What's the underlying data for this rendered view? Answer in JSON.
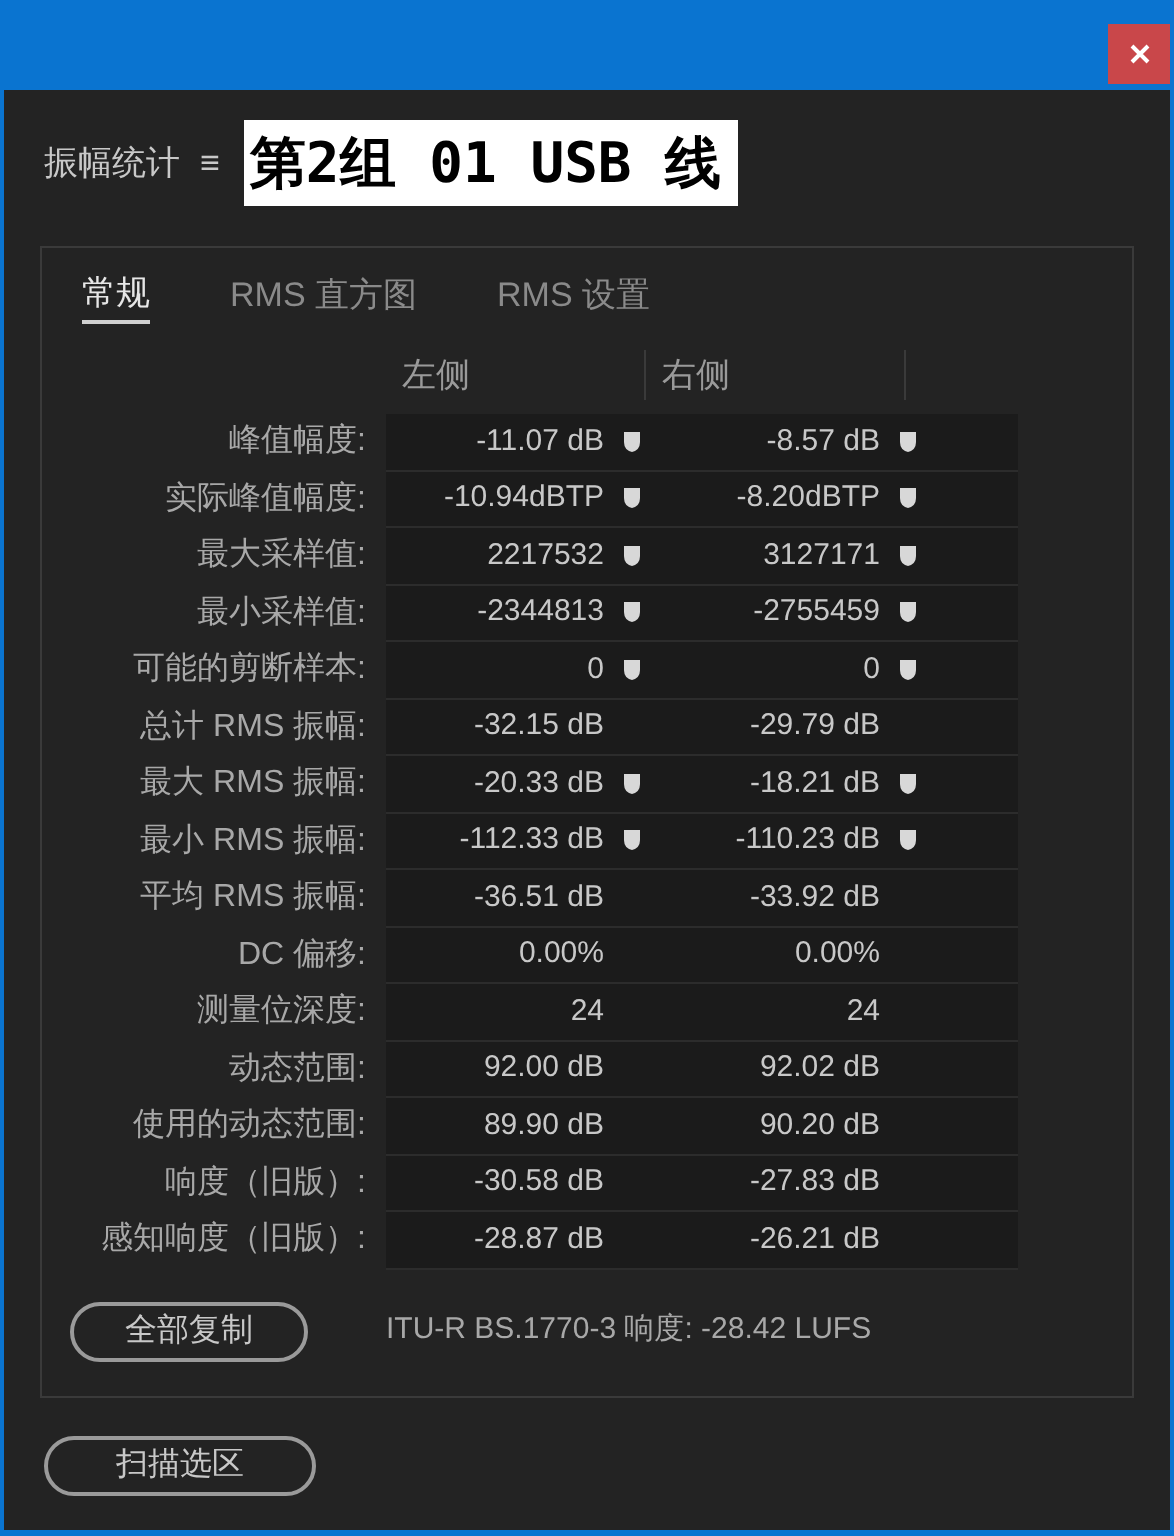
{
  "header": {
    "title": "振幅统计",
    "menu": "≡",
    "file_name": "第2组 01 USB 线"
  },
  "tabs": [
    {
      "label": "常规",
      "selected": true
    },
    {
      "label": "RMS 直方图",
      "selected": false
    },
    {
      "label": "RMS 设置",
      "selected": false
    }
  ],
  "table": {
    "columns": [
      "左侧",
      "右侧"
    ],
    "rows": [
      {
        "label": "峰值幅度:",
        "left": {
          "value": "-11.07 dB",
          "marker": true
        },
        "right": {
          "value": "-8.57 dB",
          "marker": true
        }
      },
      {
        "label": "实际峰值幅度:",
        "left": {
          "value": "-10.94dBTP",
          "marker": true
        },
        "right": {
          "value": "-8.20dBTP",
          "marker": true
        }
      },
      {
        "label": "最大采样值:",
        "left": {
          "value": "2217532",
          "marker": true
        },
        "right": {
          "value": "3127171",
          "marker": true
        }
      },
      {
        "label": "最小采样值:",
        "left": {
          "value": "-2344813",
          "marker": true
        },
        "right": {
          "value": "-2755459",
          "marker": true
        }
      },
      {
        "label": "可能的剪断样本:",
        "left": {
          "value": "0",
          "marker": true
        },
        "right": {
          "value": "0",
          "marker": true
        }
      },
      {
        "label": "总计 RMS 振幅:",
        "left": {
          "value": "-32.15 dB",
          "marker": false
        },
        "right": {
          "value": "-29.79 dB",
          "marker": false
        }
      },
      {
        "label": "最大 RMS 振幅:",
        "left": {
          "value": "-20.33 dB",
          "marker": true
        },
        "right": {
          "value": "-18.21 dB",
          "marker": true
        }
      },
      {
        "label": "最小 RMS 振幅:",
        "left": {
          "value": "-112.33 dB",
          "marker": true
        },
        "right": {
          "value": "-110.23 dB",
          "marker": true
        }
      },
      {
        "label": "平均 RMS 振幅:",
        "left": {
          "value": "-36.51 dB",
          "marker": false
        },
        "right": {
          "value": "-33.92 dB",
          "marker": false
        }
      },
      {
        "label": "DC 偏移:",
        "left": {
          "value": "0.00%",
          "marker": false
        },
        "right": {
          "value": "0.00%",
          "marker": false
        }
      },
      {
        "label": "测量位深度:",
        "left": {
          "value": "24",
          "marker": false
        },
        "right": {
          "value": "24",
          "marker": false
        }
      },
      {
        "label": "动态范围:",
        "left": {
          "value": "92.00 dB",
          "marker": false
        },
        "right": {
          "value": "92.02 dB",
          "marker": false
        }
      },
      {
        "label": "使用的动态范围:",
        "left": {
          "value": "89.90 dB",
          "marker": false
        },
        "right": {
          "value": "90.20 dB",
          "marker": false
        }
      },
      {
        "label": "响度（旧版）:",
        "left": {
          "value": "-30.58 dB",
          "marker": false
        },
        "right": {
          "value": "-27.83 dB",
          "marker": false
        }
      },
      {
        "label": "感知响度（旧版）:",
        "left": {
          "value": "-28.87 dB",
          "marker": false
        },
        "right": {
          "value": "-26.21 dB",
          "marker": false
        }
      }
    ]
  },
  "copy_button": "全部复制",
  "loudness": "ITU-R BS.1770-3 响度: -28.42 LUFS",
  "scan_button": "扫描选区"
}
